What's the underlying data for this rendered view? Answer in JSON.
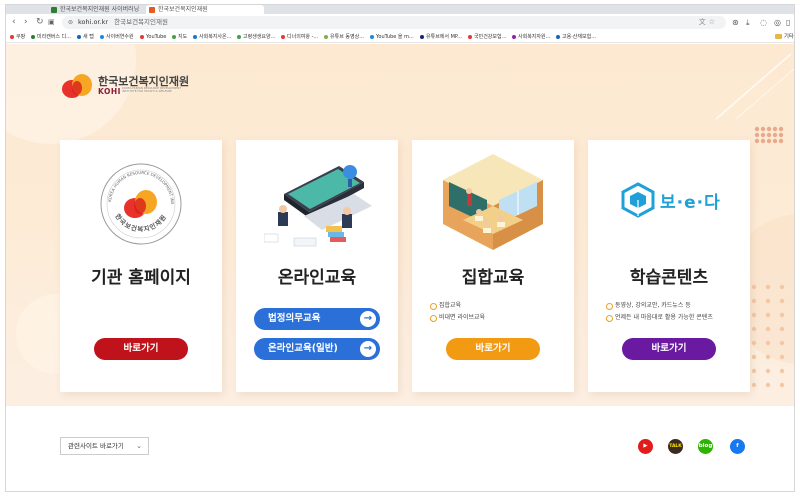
{
  "browser": {
    "tabs": [
      {
        "label": "한국보건복지인재원 사이버러닝"
      },
      {
        "label": "한국보건복지인재원"
      }
    ],
    "url": "kohi.or.kr",
    "site_name": "한국보건복지인재원",
    "bookmarks": [
      {
        "label": "쿠팡",
        "color": "#e53935"
      },
      {
        "label": "미리캔버스 디...",
        "color": "#2e7d32"
      },
      {
        "label": "새 탭",
        "color": "#1565c0"
      },
      {
        "label": "사이버연수원",
        "color": "#1e88e5"
      },
      {
        "label": "YouTube",
        "color": "#e53935"
      },
      {
        "label": "지도",
        "color": "#43a047"
      },
      {
        "label": "사회복지사온...",
        "color": "#1976d2"
      },
      {
        "label": "고령생생요양...",
        "color": "#43a047"
      },
      {
        "label": "디너의여왕 -...",
        "color": "#e53935"
      },
      {
        "label": "유튜브 동영상...",
        "color": "#7cb342"
      },
      {
        "label": "YouTube 을 m...",
        "color": "#1e88e5"
      },
      {
        "label": "유튜브에서 MP...",
        "color": "#1a237e"
      },
      {
        "label": "국민건강보험...",
        "color": "#e53935"
      },
      {
        "label": "사회복지자원...",
        "color": "#8e24aa"
      },
      {
        "label": "고용·산재보험...",
        "color": "#1565c0"
      }
    ],
    "bookmark_folder": "기타"
  },
  "logo": {
    "name": "한국보건복지인재원",
    "abbr": "KOHI",
    "subtitle": "KOREA HUMAN RESOURCE DEVELOPMENT INSTITUTE FOR HEALTH & WELFARE"
  },
  "cards": {
    "homepage": {
      "title": "기관 홈페이지",
      "seal_text": "KOREA HUMAN RESOURCE DEVELOPMENT INSTITUTE FOR HEALTH & WELFARE",
      "seal_kr": "한국보건복지인재원",
      "button": "바로가기",
      "button_color": "#c0121a"
    },
    "online": {
      "title": "온라인교육",
      "buttons": [
        "법정의무교육",
        "온라인교육(일반)"
      ],
      "button_color": "#2b6fd8"
    },
    "group": {
      "title": "집합교육",
      "bullets": [
        "집합교육",
        "비대면 라이브교육"
      ],
      "button": "바로가기",
      "button_color": "#f29a12"
    },
    "content": {
      "title": "학습콘텐츠",
      "brand": "보·e·다",
      "bullets": [
        "동영상, 강의교안, 카드뉴스 등",
        "언제든 내 마음대로 활용 가능한 콘텐츠"
      ],
      "button": "바로가기",
      "button_color": "#6a1aa0"
    }
  },
  "footer": {
    "select_label": "관련사이트 바로가기",
    "sns": [
      {
        "name": "youtube-icon",
        "text": "▶",
        "color": "#e21b1b"
      },
      {
        "name": "kakao-talk-icon",
        "text": "TALK",
        "color": "#3b2a20"
      },
      {
        "name": "blog-icon",
        "text": "blog",
        "color": "#2db400"
      },
      {
        "name": "facebook-icon",
        "text": "f",
        "color": "#1877f2"
      }
    ]
  }
}
